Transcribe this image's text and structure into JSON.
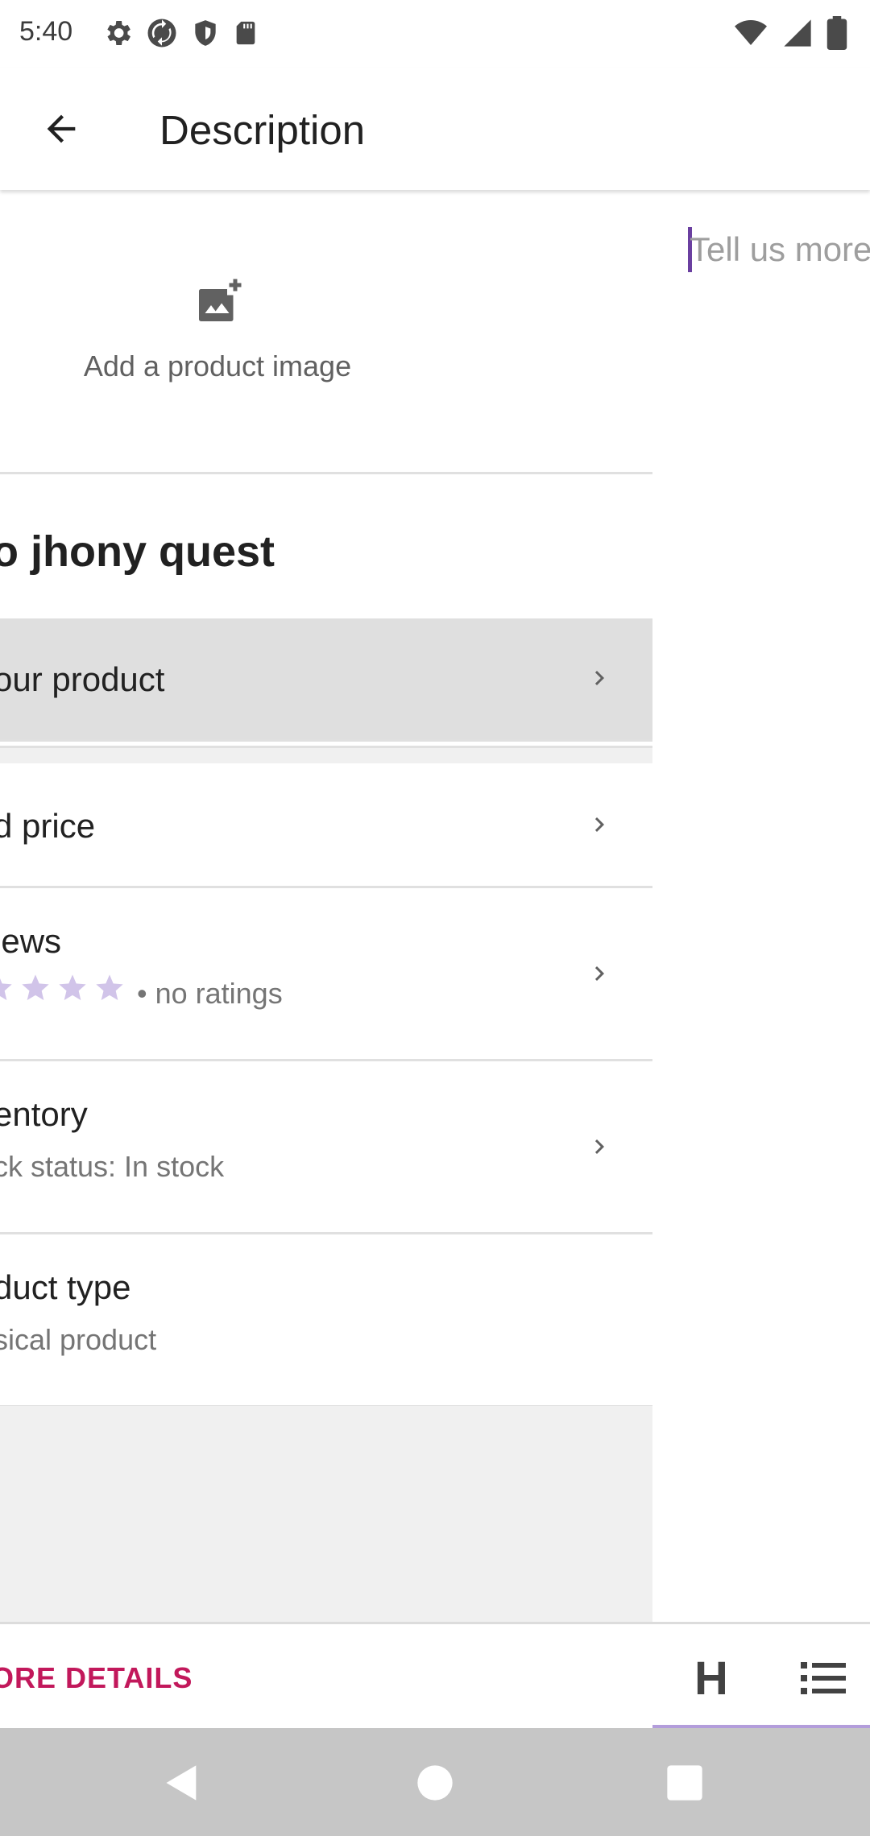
{
  "status_bar": {
    "time": "5:40",
    "left_icons": [
      "settings-icon",
      "sync-icon",
      "shield-icon",
      "sd-card-icon"
    ],
    "right_icons": [
      "wifi-icon",
      "signal-icon",
      "battery-icon"
    ]
  },
  "app_bar": {
    "back_icon": "arrow-back-icon",
    "title": "Description"
  },
  "product_panel": {
    "add_image_label": "Add a product image",
    "product_title": "o jhony quest",
    "rows": [
      {
        "title": "our product",
        "subtitle": ""
      },
      {
        "title": "d price",
        "subtitle": ""
      },
      {
        "title": "iews",
        "subtitle": "• no ratings"
      },
      {
        "title": "entory",
        "subtitle": "ck status: In stock"
      },
      {
        "title": "duct type",
        "subtitle": "sical product"
      }
    ],
    "rating_stars": 0
  },
  "description_editor": {
    "placeholder": "Tell us more"
  },
  "bottom_bar": {
    "more_details_label": "IORE DETAILS",
    "heading_tool": "H",
    "list_tool_icon": "bullet-list-icon"
  },
  "nav_bar": {
    "icons": [
      "nav-back-icon",
      "nav-home-icon",
      "nav-recents-icon"
    ]
  },
  "colors": {
    "accent": "#c2185b",
    "cursor": "#6a3fa0",
    "tool_underline": "#b39ddb",
    "star": "#d1c4e9"
  }
}
